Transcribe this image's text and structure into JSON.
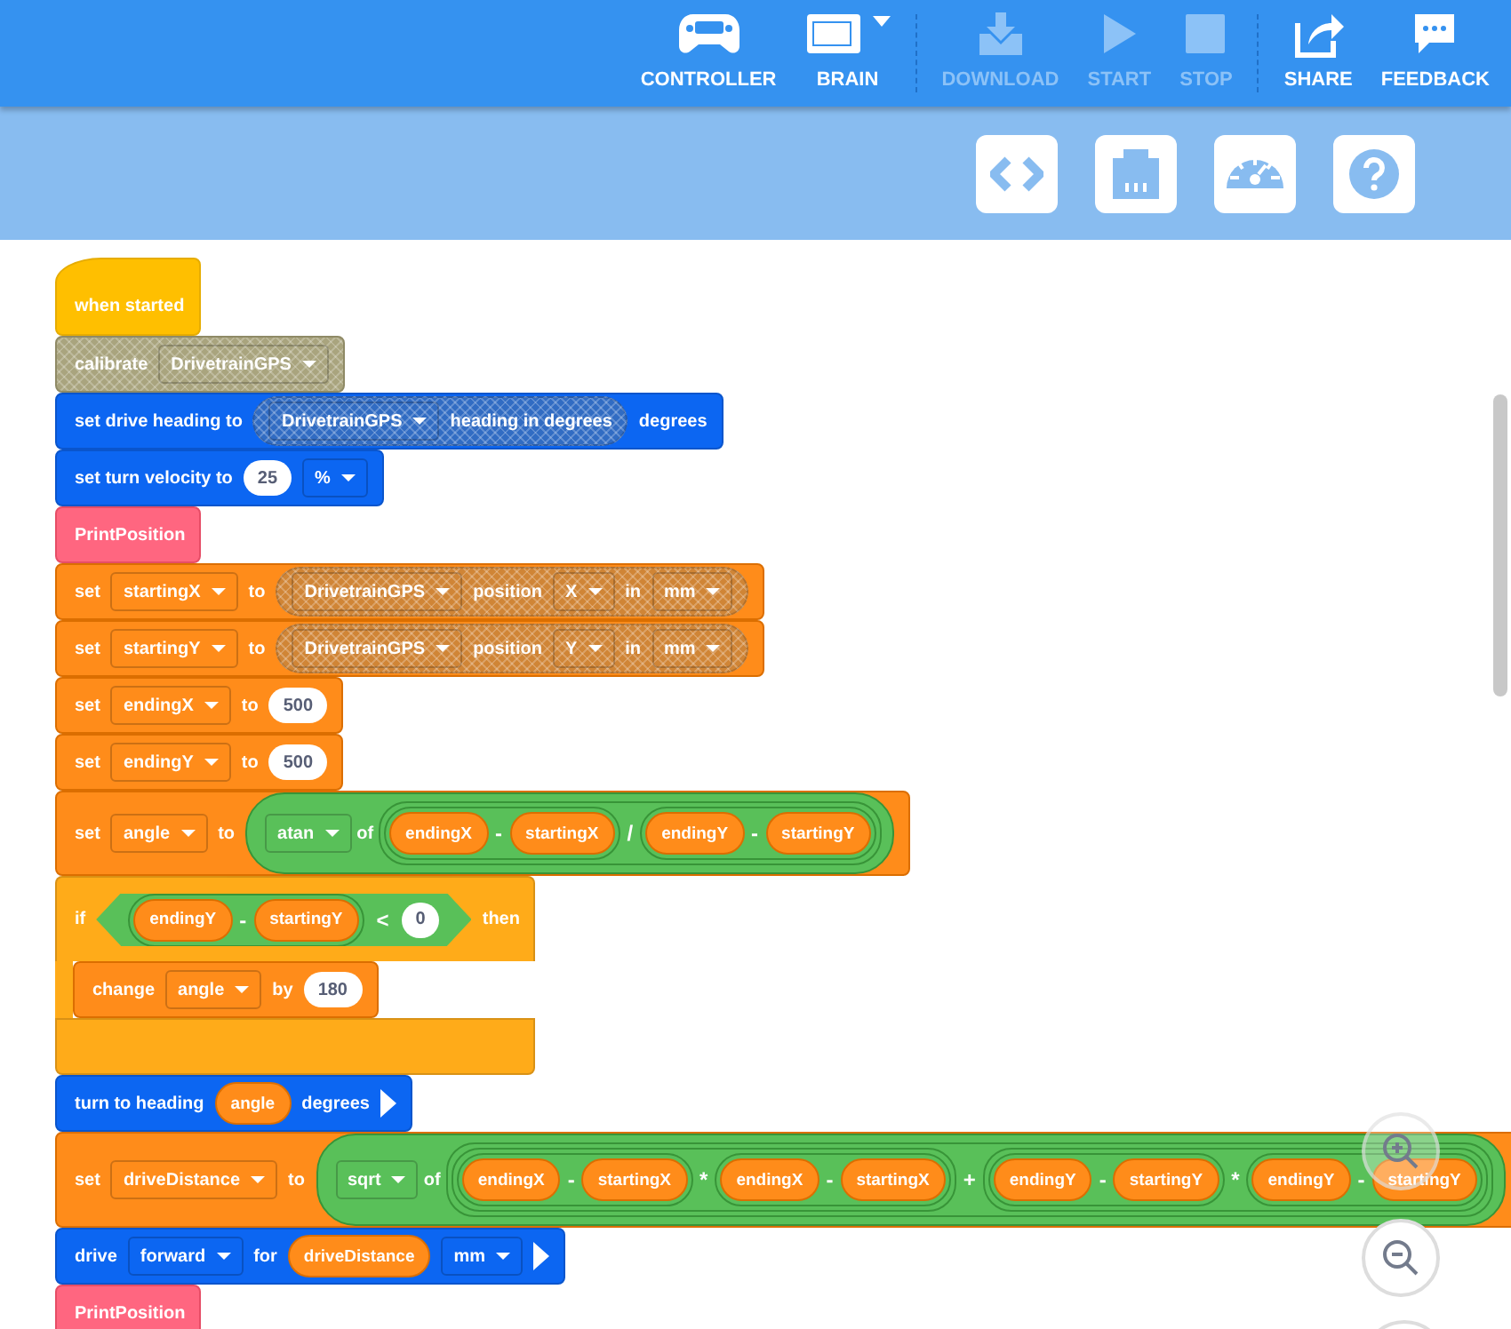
{
  "toolbar": {
    "items": [
      {
        "kind": "controller",
        "label": "CONTROLLER",
        "disabled": false
      },
      {
        "kind": "brain",
        "label": "BRAIN",
        "disabled": false
      },
      {
        "kind": "download",
        "label": "DOWNLOAD",
        "disabled": true
      },
      {
        "kind": "start",
        "label": "START",
        "disabled": true
      },
      {
        "kind": "stop",
        "label": "STOP",
        "disabled": true
      },
      {
        "kind": "share",
        "label": "SHARE",
        "disabled": false
      },
      {
        "kind": "feedback",
        "label": "FEEDBACK",
        "disabled": false
      }
    ]
  },
  "blocks": [
    {
      "kind": "event",
      "disabled": false,
      "parts": [
        {
          "kind": "label",
          "text": "when started"
        }
      ]
    },
    {
      "kind": "sensing",
      "disabled": true,
      "parts": [
        {
          "kind": "label",
          "text": "calibrate"
        },
        {
          "kind": "dropdown",
          "text": "DrivetrainGPS"
        }
      ]
    },
    {
      "kind": "drivetrain",
      "disabled": false,
      "parts": [
        {
          "kind": "label",
          "text": "set drive heading to"
        },
        {
          "kind": "reporter",
          "disabled": true,
          "parts": [
            {
              "kind": "dropdown",
              "text": "DrivetrainGPS"
            },
            {
              "kind": "label",
              "text": "heading in degrees"
            }
          ]
        },
        {
          "kind": "label",
          "text": "degrees"
        }
      ]
    },
    {
      "kind": "drivetrain",
      "disabled": false,
      "parts": [
        {
          "kind": "label",
          "text": "set turn velocity to"
        },
        {
          "kind": "number",
          "text": "25"
        },
        {
          "kind": "dropdown",
          "text": "%"
        }
      ]
    },
    {
      "kind": "myblock",
      "disabled": false,
      "parts": [
        {
          "kind": "label",
          "text": "PrintPosition"
        }
      ]
    },
    {
      "kind": "variable",
      "disabled": false,
      "parts": [
        {
          "kind": "label",
          "text": "set"
        },
        {
          "kind": "dropdown",
          "text": "startingX"
        },
        {
          "kind": "label",
          "text": "to"
        },
        {
          "kind": "reporter",
          "disabled": true,
          "parts": [
            {
              "kind": "dropdown",
              "text": "DrivetrainGPS"
            },
            {
              "kind": "label",
              "text": "position"
            },
            {
              "kind": "dropdown",
              "text": "X"
            },
            {
              "kind": "label",
              "text": "in"
            },
            {
              "kind": "dropdown",
              "text": "mm"
            }
          ]
        }
      ]
    },
    {
      "kind": "variable",
      "disabled": false,
      "parts": [
        {
          "kind": "label",
          "text": "set"
        },
        {
          "kind": "dropdown",
          "text": "startingY"
        },
        {
          "kind": "label",
          "text": "to"
        },
        {
          "kind": "reporter",
          "disabled": true,
          "parts": [
            {
              "kind": "dropdown",
              "text": "DrivetrainGPS"
            },
            {
              "kind": "label",
              "text": "position"
            },
            {
              "kind": "dropdown",
              "text": "Y"
            },
            {
              "kind": "label",
              "text": "in"
            },
            {
              "kind": "dropdown",
              "text": "mm"
            }
          ]
        }
      ]
    },
    {
      "kind": "variable",
      "disabled": false,
      "parts": [
        {
          "kind": "label",
          "text": "set"
        },
        {
          "kind": "dropdown",
          "text": "endingX"
        },
        {
          "kind": "label",
          "text": "to"
        },
        {
          "kind": "number",
          "text": "500"
        }
      ]
    },
    {
      "kind": "variable",
      "disabled": false,
      "parts": [
        {
          "kind": "label",
          "text": "set"
        },
        {
          "kind": "dropdown",
          "text": "endingY"
        },
        {
          "kind": "label",
          "text": "to"
        },
        {
          "kind": "number",
          "text": "500"
        }
      ]
    },
    {
      "kind": "variable",
      "disabled": false,
      "parts": [
        {
          "kind": "label",
          "text": "set"
        },
        {
          "kind": "dropdown",
          "text": "angle"
        },
        {
          "kind": "label",
          "text": "to"
        },
        {
          "kind": "operator",
          "parts": [
            {
              "kind": "dropdown",
              "text": "atan"
            },
            {
              "kind": "label",
              "text": "of"
            },
            {
              "kind": "operator",
              "parts": [
                {
                  "kind": "operator",
                  "parts": [
                    {
                      "kind": "var",
                      "text": "endingX"
                    },
                    {
                      "kind": "symbol",
                      "text": "-"
                    },
                    {
                      "kind": "var",
                      "text": "startingX"
                    }
                  ]
                },
                {
                  "kind": "symbol",
                  "text": "/"
                },
                {
                  "kind": "operator",
                  "parts": [
                    {
                      "kind": "var",
                      "text": "endingY"
                    },
                    {
                      "kind": "symbol",
                      "text": "-"
                    },
                    {
                      "kind": "var",
                      "text": "startingY"
                    }
                  ]
                }
              ]
            }
          ]
        }
      ]
    },
    {
      "kind": "if",
      "disabled": false,
      "parts": [
        {
          "kind": "label",
          "text": "if"
        },
        {
          "kind": "condition",
          "parts": [
            {
              "kind": "operator",
              "parts": [
                {
                  "kind": "var",
                  "text": "endingY"
                },
                {
                  "kind": "symbol",
                  "text": "-"
                },
                {
                  "kind": "var",
                  "text": "startingY"
                }
              ]
            },
            {
              "kind": "symbol",
              "text": "<"
            },
            {
              "kind": "number",
              "text": "0"
            }
          ]
        },
        {
          "kind": "label",
          "text": "then"
        }
      ],
      "children": [
        {
          "kind": "variable",
          "disabled": false,
          "parts": [
            {
              "kind": "label",
              "text": "change"
            },
            {
              "kind": "dropdown",
              "text": "angle"
            },
            {
              "kind": "label",
              "text": "by"
            },
            {
              "kind": "number",
              "text": "180"
            }
          ]
        }
      ]
    },
    {
      "kind": "drivetrain",
      "disabled": false,
      "parts": [
        {
          "kind": "label",
          "text": "turn to heading"
        },
        {
          "kind": "var",
          "text": "angle"
        },
        {
          "kind": "label",
          "text": "degrees"
        },
        {
          "kind": "arrow"
        }
      ]
    },
    {
      "kind": "variable",
      "disabled": false,
      "parts": [
        {
          "kind": "label",
          "text": "set"
        },
        {
          "kind": "dropdown",
          "text": "driveDistance"
        },
        {
          "kind": "label",
          "text": "to"
        },
        {
          "kind": "operator",
          "parts": [
            {
              "kind": "dropdown",
              "text": "sqrt"
            },
            {
              "kind": "label",
              "text": "of"
            },
            {
              "kind": "operator",
              "parts": [
                {
                  "kind": "operator",
                  "parts": [
                    {
                      "kind": "operator",
                      "parts": [
                        {
                          "kind": "var",
                          "text": "endingX"
                        },
                        {
                          "kind": "symbol",
                          "text": "-"
                        },
                        {
                          "kind": "var",
                          "text": "startingX"
                        }
                      ]
                    },
                    {
                      "kind": "symbol",
                      "text": "*"
                    },
                    {
                      "kind": "operator",
                      "parts": [
                        {
                          "kind": "var",
                          "text": "endingX"
                        },
                        {
                          "kind": "symbol",
                          "text": "-"
                        },
                        {
                          "kind": "var",
                          "text": "startingX"
                        }
                      ]
                    }
                  ]
                },
                {
                  "kind": "symbol",
                  "text": "+"
                },
                {
                  "kind": "operator",
                  "parts": [
                    {
                      "kind": "operator",
                      "parts": [
                        {
                          "kind": "var",
                          "text": "endingY"
                        },
                        {
                          "kind": "symbol",
                          "text": "-"
                        },
                        {
                          "kind": "var",
                          "text": "startingY"
                        }
                      ]
                    },
                    {
                      "kind": "symbol",
                      "text": "*"
                    },
                    {
                      "kind": "operator",
                      "parts": [
                        {
                          "kind": "var",
                          "text": "endingY"
                        },
                        {
                          "kind": "symbol",
                          "text": "-"
                        },
                        {
                          "kind": "var",
                          "text": "startingY"
                        }
                      ]
                    }
                  ]
                }
              ]
            }
          ]
        }
      ]
    },
    {
      "kind": "drivetrain",
      "disabled": false,
      "parts": [
        {
          "kind": "label",
          "text": "drive"
        },
        {
          "kind": "dropdown",
          "text": "forward"
        },
        {
          "kind": "label",
          "text": "for"
        },
        {
          "kind": "var",
          "text": "driveDistance"
        },
        {
          "kind": "dropdown",
          "text": "mm"
        },
        {
          "kind": "arrow"
        }
      ]
    },
    {
      "kind": "myblock",
      "disabled": false,
      "parts": [
        {
          "kind": "label",
          "text": "PrintPosition"
        }
      ]
    }
  ]
}
